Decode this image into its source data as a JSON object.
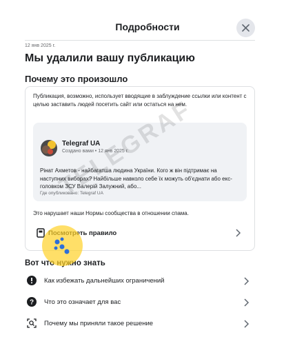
{
  "header": {
    "title": "Подробности",
    "close_icon": "close-icon"
  },
  "date": "12 янв 2025 г.",
  "main_title": "Мы удалили вашу публикацию",
  "section_title": "Почему это произошло",
  "card": {
    "description": "Публикация, возможно, использует вводящие в заблуждение ссылки или контент с целью заставить людей посетить сайт или остаться на нем.",
    "post": {
      "author": "Telegraf UA",
      "meta": "Создано вами • 12 янв 2025 г.",
      "text": "Рінат Ахметов - найбагатша людина України. Кого ж він підтримає на наступних виборах? Найбільше навколо себе їх можуть об'єднати або екс-головком ЗСУ Валерій Залужний, або...",
      "published_where": "Где опубликовано: Telegraf UA"
    },
    "violates_text": "Это нарушает наши Нормы сообщества в отношении спама.",
    "rule_label": "Посмотреть правило"
  },
  "know": {
    "title": "Вот что нужно знать",
    "items": [
      {
        "label": "Как избежать дальнейших ограничений",
        "icon": "exclamation-circle-icon"
      },
      {
        "label": "Что это означает для вас",
        "icon": "question-circle-icon"
      },
      {
        "label": "Почему мы приняли такое решение",
        "icon": "search-scan-icon"
      }
    ]
  },
  "watermark": "TELEGRAF",
  "colors": {
    "text": "#1c1e21",
    "secondary": "#65676b",
    "divider": "#dddfe2",
    "close_bg": "#e4e6eb",
    "post_bg": "#f0f2f5",
    "highlight": "#ffd228"
  }
}
